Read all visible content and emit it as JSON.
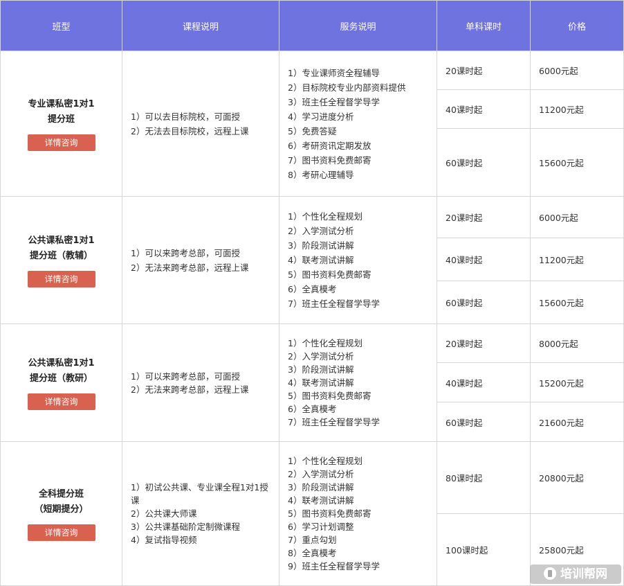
{
  "headers": [
    "班型",
    "课程说明",
    "服务说明",
    "单科课时",
    "价格"
  ],
  "consult_label": "详情咨询",
  "rows": [
    {
      "name_lines": [
        "专业课私密1对1",
        "提分班"
      ],
      "course": [
        "1）可以去目标院校，可面授",
        "2）无法去目标院校，远程上课"
      ],
      "service": [
        "1）专业课师资全程辅导",
        "2）目标院校专业内部资料提供",
        "3）班主任全程督学导学",
        "4）学习进度分析",
        "5）免费答疑",
        "6）考研资讯定期发放",
        "7）图书资料免费邮寄",
        "8）考研心理辅导"
      ],
      "options": [
        {
          "hours": "20课时起",
          "price": "6000元起"
        },
        {
          "hours": "40课时起",
          "price": "11200元起"
        },
        {
          "hours": "60课时起",
          "price": "15600元起"
        }
      ]
    },
    {
      "name_lines": [
        "公共课私密1对1",
        "提分班（教辅）"
      ],
      "course": [
        "1）可以来跨考总部，可面授",
        "2）无法来跨考总部，远程上课"
      ],
      "service": [
        "1）个性化全程规划",
        "2）入学测试分析",
        "3）阶段测试讲解",
        "4）联考测试讲解",
        "5）图书资料免费邮寄",
        "6）全真模考",
        "7）班主任全程督学导学"
      ],
      "options": [
        {
          "hours": "20课时起",
          "price": "6000元起"
        },
        {
          "hours": "40课时起",
          "price": "11200元起"
        },
        {
          "hours": "60课时起",
          "price": "15600元起"
        }
      ]
    },
    {
      "name_lines": [
        "公共课私密1对1",
        "提分班（教研）"
      ],
      "course": [
        "1）可以来跨考总部，可面授",
        "2）无法来跨考总部，远程上课"
      ],
      "service": [
        "1）个性化全程规划",
        "2）入学测试分析",
        "3）阶段测试讲解",
        "4）联考测试讲解",
        "5）图书资料免费邮寄",
        "6）全真模考",
        "7）班主任全程督学导学"
      ],
      "options": [
        {
          "hours": "20课时起",
          "price": "8000元起"
        },
        {
          "hours": "40课时起",
          "price": "15200元起"
        },
        {
          "hours": "60课时起",
          "price": "21600元起"
        }
      ]
    },
    {
      "name_lines": [
        "全科提分班",
        "（短期提分）"
      ],
      "course": [
        "1）初试公共课、专业课全程1对1授课",
        "2）公共课大师课",
        "3）公共课基础阶定制微课程",
        "4）复试指导视频"
      ],
      "service": [
        "1）个性化全程规划",
        "2）入学测试分析",
        "3）阶段测试讲解",
        "4）联考测试讲解",
        "5）图书资料免费邮寄",
        "6）学习计划调整",
        "7）重点勾划",
        "8）全真模考",
        "9）班主任全程督学导学"
      ],
      "options": [
        {
          "hours": "80课时起",
          "price": "20800元起"
        },
        {
          "hours": "100课时起",
          "price": "25800元起"
        }
      ]
    }
  ],
  "watermark": "培训帮网"
}
